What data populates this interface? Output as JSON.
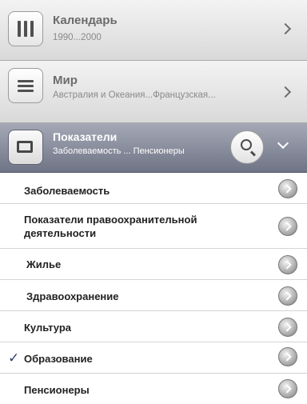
{
  "panels": {
    "calendar": {
      "title": "Календарь",
      "subtitle": "1990...2000"
    },
    "world": {
      "title": "Мир",
      "subtitle": "Австралия и Океания...Французская..."
    },
    "indicators": {
      "title": "Показатели",
      "subtitle": "Заболеваемость ... Пенсионеры"
    }
  },
  "list": {
    "items": [
      {
        "label": "Заболеваемость",
        "checked": false
      },
      {
        "label": "Показатели правоохранительной деятельности",
        "checked": false
      },
      {
        "label": "Жилье",
        "checked": false
      },
      {
        "label": "Здравоохранение",
        "checked": false
      },
      {
        "label": "Культура",
        "checked": false
      },
      {
        "label": "Образование",
        "checked": true
      },
      {
        "label": "Пенсионеры",
        "checked": false
      }
    ],
    "check_glyph": "✓"
  },
  "colors": {
    "active_header": "#7d8293",
    "check": "#2d3f6e"
  }
}
